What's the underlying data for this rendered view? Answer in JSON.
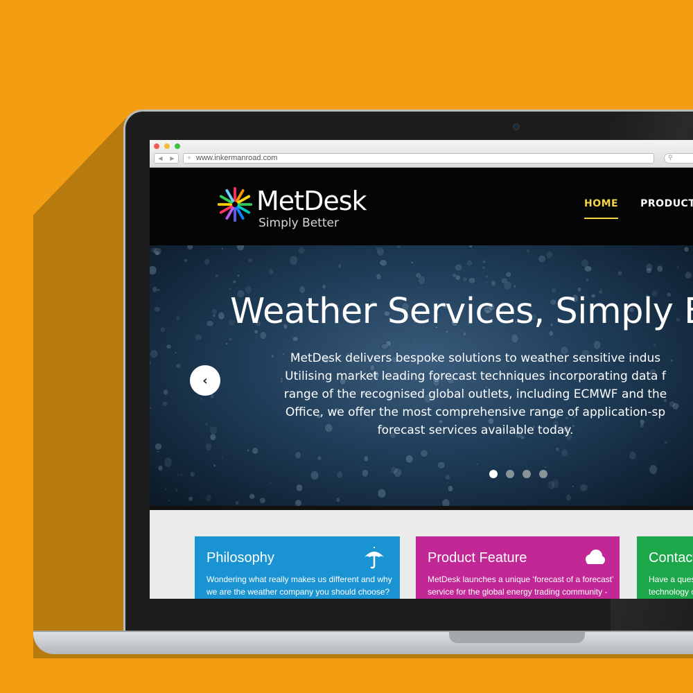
{
  "browser": {
    "url": "www.inkermanroad.com"
  },
  "site": {
    "logo_name": "MetDesk",
    "logo_tagline": "Simply Better",
    "nav": [
      {
        "label": "HOME",
        "active": true
      },
      {
        "label": "PRODUCTS",
        "active": false
      }
    ]
  },
  "hero": {
    "title": "Weather Services, Simply B",
    "lines": [
      "MetDesk delivers bespoke solutions to weather sensitive indus",
      "Utilising market leading forecast techniques incorporating data f",
      "range of the recognised global outlets, including ECMWF and the",
      "Office, we offer the most comprehensive range of application-sp",
      "forecast services available today."
    ],
    "prev_icon": "chevron-left-icon",
    "slides": 4,
    "active_slide": 1
  },
  "features": [
    {
      "title": "Philosophy",
      "body": [
        "Wondering what really makes us different and why",
        "we are the weather company you should choose?"
      ],
      "icon": "umbrella-icon",
      "color": "#1a93d3"
    },
    {
      "title": "Product Feature",
      "body": [
        "MetDesk launches a unique ‘forecast of a forecast’",
        "service for the global energy trading community -"
      ],
      "icon": "cloud-icon",
      "color": "#c12896"
    },
    {
      "title": "Contact",
      "body": [
        "Have a quest",
        "technology or"
      ],
      "icon": "",
      "color": "#1ca84a"
    }
  ],
  "colors": {
    "background": "#f29d12",
    "nav_active": "#f5d547"
  }
}
